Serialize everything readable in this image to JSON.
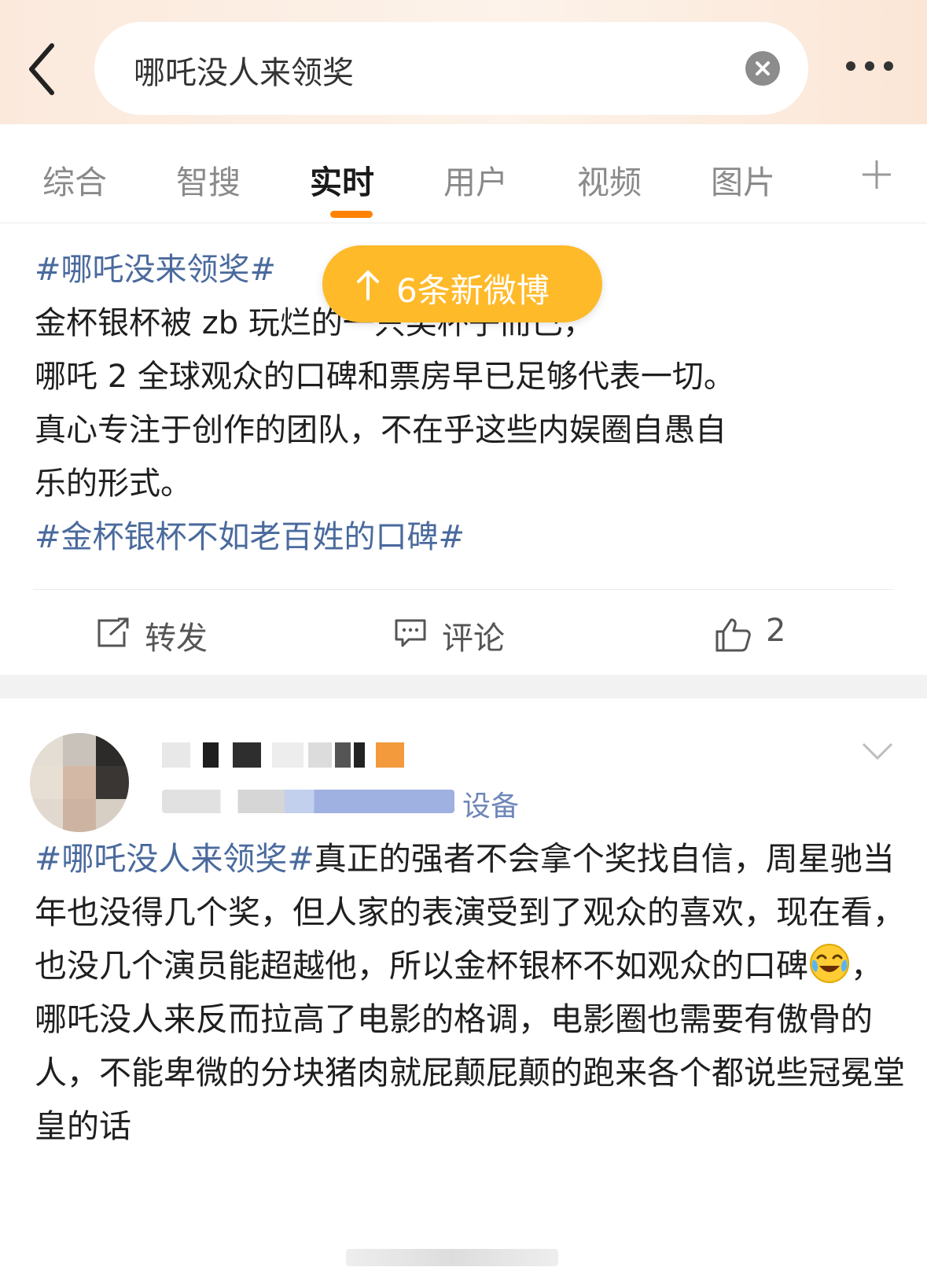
{
  "header": {
    "search_query": "哪吒没人来领奖",
    "icons": [
      "back-icon",
      "clear-icon",
      "more-icon"
    ]
  },
  "tabs": [
    {
      "label": "综合"
    },
    {
      "label": "智搜"
    },
    {
      "label": "实时",
      "active": true
    },
    {
      "label": "用户"
    },
    {
      "label": "视频"
    },
    {
      "label": "图片"
    }
  ],
  "new_posts_banner": {
    "label": "6条新微博"
  },
  "post1": {
    "tag_top": "#哪吒没来领奖#",
    "line1": "金杯银杯被 zb 玩烂的一只奖杯子而已，",
    "line2": "哪吒 2 全球观众的口碑和票房早已足够代表一切。",
    "line3": "真心专注于创作的团队，不在乎这些内娱圈自愚自",
    "line4": "乐的形式。",
    "tag_bottom": "#金杯银杯不如老百姓的口碑#",
    "actions": {
      "repost": "转发",
      "comment": "评论",
      "like_count": "2"
    }
  },
  "post2": {
    "source_device": "设备",
    "tag": "#哪吒没人来领奖#",
    "text1": "真正的强者不会拿个奖找自信，周星驰当年也没得几个奖，但人家的表演受到了观众的喜欢，现在看，也没几个演员能超越他，所以金杯银杯不如观众的口碑",
    "text2": "，哪吒没人来反而拉高了电影的格调，电影圈也需要有傲骨的人，不能卑微的分块猪肉就屁颠屁颠的跑来各个都说些冠冕堂皇的话",
    "emoji": "laugh-cry-emoji"
  },
  "colors": {
    "accent": "#ff8200",
    "banner": "#ffba2a",
    "topic_link": "#4a6a9d"
  }
}
